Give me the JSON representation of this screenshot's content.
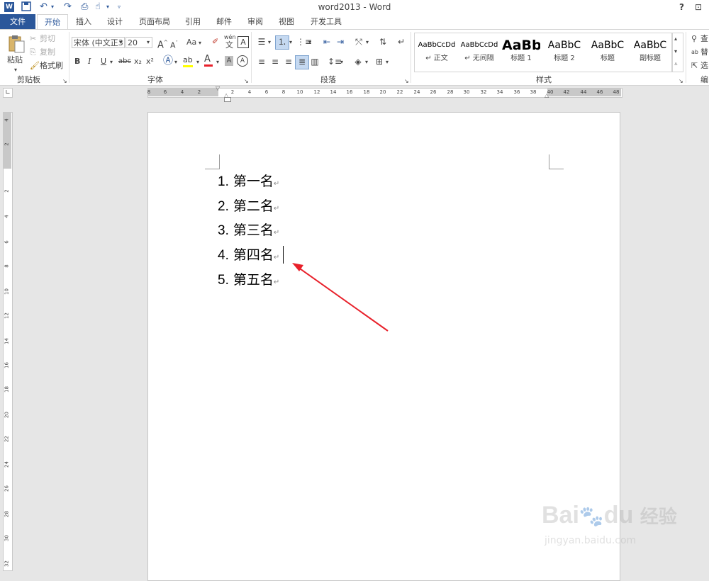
{
  "titlebar": {
    "title": "word2013 - Word",
    "help": "?",
    "restore_symbol": "⊡"
  },
  "tabs": [
    "文件",
    "开始",
    "插入",
    "设计",
    "页面布局",
    "引用",
    "邮件",
    "审阅",
    "视图",
    "开发工具"
  ],
  "clipboard": {
    "paste": "粘贴",
    "cut": "剪切",
    "copy": "复制",
    "format_painter": "格式刷",
    "group_label": "剪贴板"
  },
  "font": {
    "font_name": "宋体 (中文正3",
    "font_size": "20",
    "group_label": "字体",
    "aa": "Aa",
    "wen": "wén",
    "wen_char": "文",
    "big_a": "A",
    "small_a": "A",
    "char_a": "A",
    "bold": "B",
    "italic": "I",
    "underline": "U",
    "strike": "abc",
    "sub": "x₂",
    "sup": "x²"
  },
  "paragraph": {
    "group_label": "段落"
  },
  "styles": {
    "group_label": "样式",
    "items": [
      {
        "sample": "AaBbCcDd",
        "name": "↵ 正文"
      },
      {
        "sample": "AaBbCcDd",
        "name": "↵ 无间隔"
      },
      {
        "sample": "AaBb",
        "name": "标题 1"
      },
      {
        "sample": "AaBbC",
        "name": "标题 2"
      },
      {
        "sample": "AaBbC",
        "name": "标题"
      },
      {
        "sample": "AaBbC",
        "name": "副标题"
      }
    ]
  },
  "editing": {
    "find": "查",
    "replace": "替",
    "select": "选",
    "group_label": "编"
  },
  "ruler": {
    "h_ticks": [
      "8",
      "6",
      "4",
      "2",
      "2",
      "4",
      "6",
      "8",
      "10",
      "12",
      "14",
      "16",
      "18",
      "20",
      "22",
      "24",
      "26",
      "28",
      "30",
      "32",
      "34",
      "36",
      "38",
      "40",
      "42",
      "44",
      "46",
      "48"
    ],
    "v_ticks": [
      "4",
      "2",
      "2",
      "4",
      "6",
      "8",
      "10",
      "12",
      "14",
      "16",
      "18",
      "20",
      "22",
      "24",
      "26",
      "28",
      "30",
      "32"
    ]
  },
  "document": {
    "list": [
      {
        "num": "1.",
        "text": "第一名"
      },
      {
        "num": "2.",
        "text": "第二名"
      },
      {
        "num": "3.",
        "text": "第三名"
      },
      {
        "num": "4.",
        "text": "第四名"
      },
      {
        "num": "5.",
        "text": "第五名"
      }
    ],
    "para_mark": "↵"
  },
  "watermark": {
    "brand": "Bai",
    "brand2": "du",
    "jingyan": "经验",
    "url": "jingyan.baidu.com"
  },
  "colors": {
    "accent": "#2b579a",
    "arrow": "#e8202a",
    "highlight_yellow": "#ffff00",
    "font_red": "#e8202a"
  }
}
